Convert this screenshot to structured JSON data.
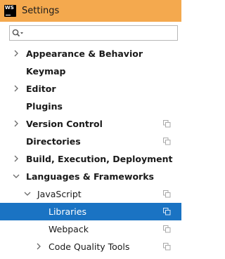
{
  "window": {
    "title": "Settings",
    "logo_text": "WS"
  },
  "search": {
    "placeholder": ""
  },
  "tree": [
    {
      "label": "Appearance & Behavior",
      "expander": "collapsed",
      "bold": true,
      "project_icon": false
    },
    {
      "label": "Keymap",
      "expander": "none",
      "bold": true,
      "project_icon": false
    },
    {
      "label": "Editor",
      "expander": "collapsed",
      "bold": true,
      "project_icon": false
    },
    {
      "label": "Plugins",
      "expander": "none",
      "bold": true,
      "project_icon": false
    },
    {
      "label": "Version Control",
      "expander": "collapsed",
      "bold": true,
      "project_icon": true
    },
    {
      "label": "Directories",
      "expander": "none",
      "bold": true,
      "project_icon": true
    },
    {
      "label": "Build, Execution, Deployment",
      "expander": "collapsed",
      "bold": true,
      "project_icon": false
    },
    {
      "label": "Languages & Frameworks",
      "expander": "expanded",
      "bold": true,
      "project_icon": false
    },
    {
      "label": "JavaScript",
      "expander": "expanded",
      "bold": false,
      "project_icon": true
    },
    {
      "label": "Libraries",
      "expander": "none",
      "bold": false,
      "project_icon": true,
      "selected": true
    },
    {
      "label": "Webpack",
      "expander": "none",
      "bold": false,
      "project_icon": true
    },
    {
      "label": "Code Quality Tools",
      "expander": "collapsed",
      "bold": false,
      "project_icon": true
    }
  ],
  "colors": {
    "titlebar": "#f4a94e",
    "selection": "#1a73c3"
  }
}
